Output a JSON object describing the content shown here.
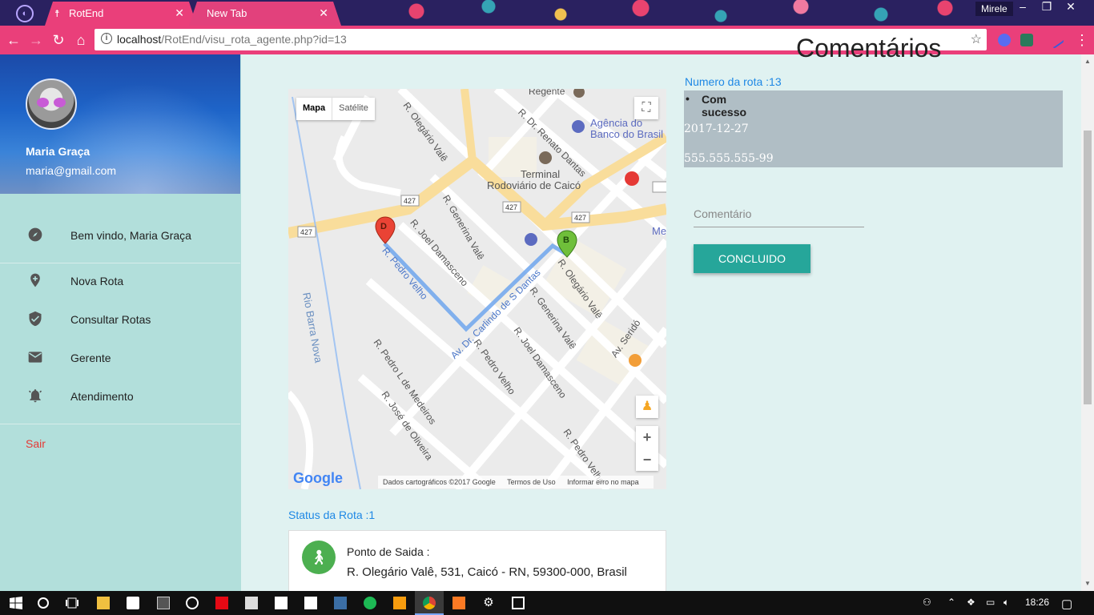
{
  "browser": {
    "tabs": [
      {
        "label": "RotEnd",
        "active": true
      },
      {
        "label": "New Tab",
        "active": false
      }
    ],
    "user": "Mirele",
    "url_host": "localhost",
    "url_path": "/RotEnd/visu_rota_agente.php?id=13"
  },
  "sidebar": {
    "user_name": "Maria Graça",
    "user_email": "maria@gmail.com",
    "items": [
      {
        "label": "Bem vindo, Maria Graça",
        "icon": "compass-icon"
      },
      {
        "label": "Nova Rota",
        "icon": "add-location-icon"
      },
      {
        "label": "Consultar Rotas",
        "icon": "verified-shield-icon"
      },
      {
        "label": "Gerente",
        "icon": "email-icon"
      },
      {
        "label": "Atendimento",
        "icon": "alarm-bell-icon"
      }
    ],
    "logout": "Sair"
  },
  "map": {
    "type_map": "Mapa",
    "type_satellite": "Satélite",
    "attribution": "Dados cartográficos ©2017 Google",
    "terms": "Termos de Uso",
    "report": "Informar erro no mapa",
    "logo": "Google",
    "labels": {
      "regente": "Regente",
      "agencia1": "Agência do",
      "agencia2": "Banco do Brasil",
      "terminal1": "Terminal",
      "terminal2": "Rodoviário de Caicó",
      "rio": "Rio Barra Nova",
      "olegario": "R. Olegário Valê",
      "renato": "R. Dr. Renato Dantas",
      "generina": "R. Generina Valê",
      "joel": "R. Joel Damasceno",
      "pedro": "R. Pedro Velho",
      "carlindo": "Av. Dr. Carlindo de S Dantas",
      "seridó": "Av. Seridó",
      "medeiros": "R. Pedro L de Medeiros",
      "jose": "R. José de Oliveira",
      "road427": "427",
      "me": "Me"
    },
    "markers": {
      "start": "B",
      "end": "D"
    }
  },
  "status": {
    "title": "Status da Rota :1",
    "line1": "Ponto de Saida :",
    "line2": "R. Olegário Valê, 531, Caicó - RN, 59300-000, Brasil"
  },
  "comments": {
    "heading": "Comentários",
    "route_number": "Numero da rota :13",
    "result": "Com sucesso",
    "date": "2017-12-27",
    "phone": "555.555.555-99",
    "placeholder": "Comentário",
    "button": "CONCLUIDO"
  },
  "taskbar": {
    "time": "18:26"
  }
}
